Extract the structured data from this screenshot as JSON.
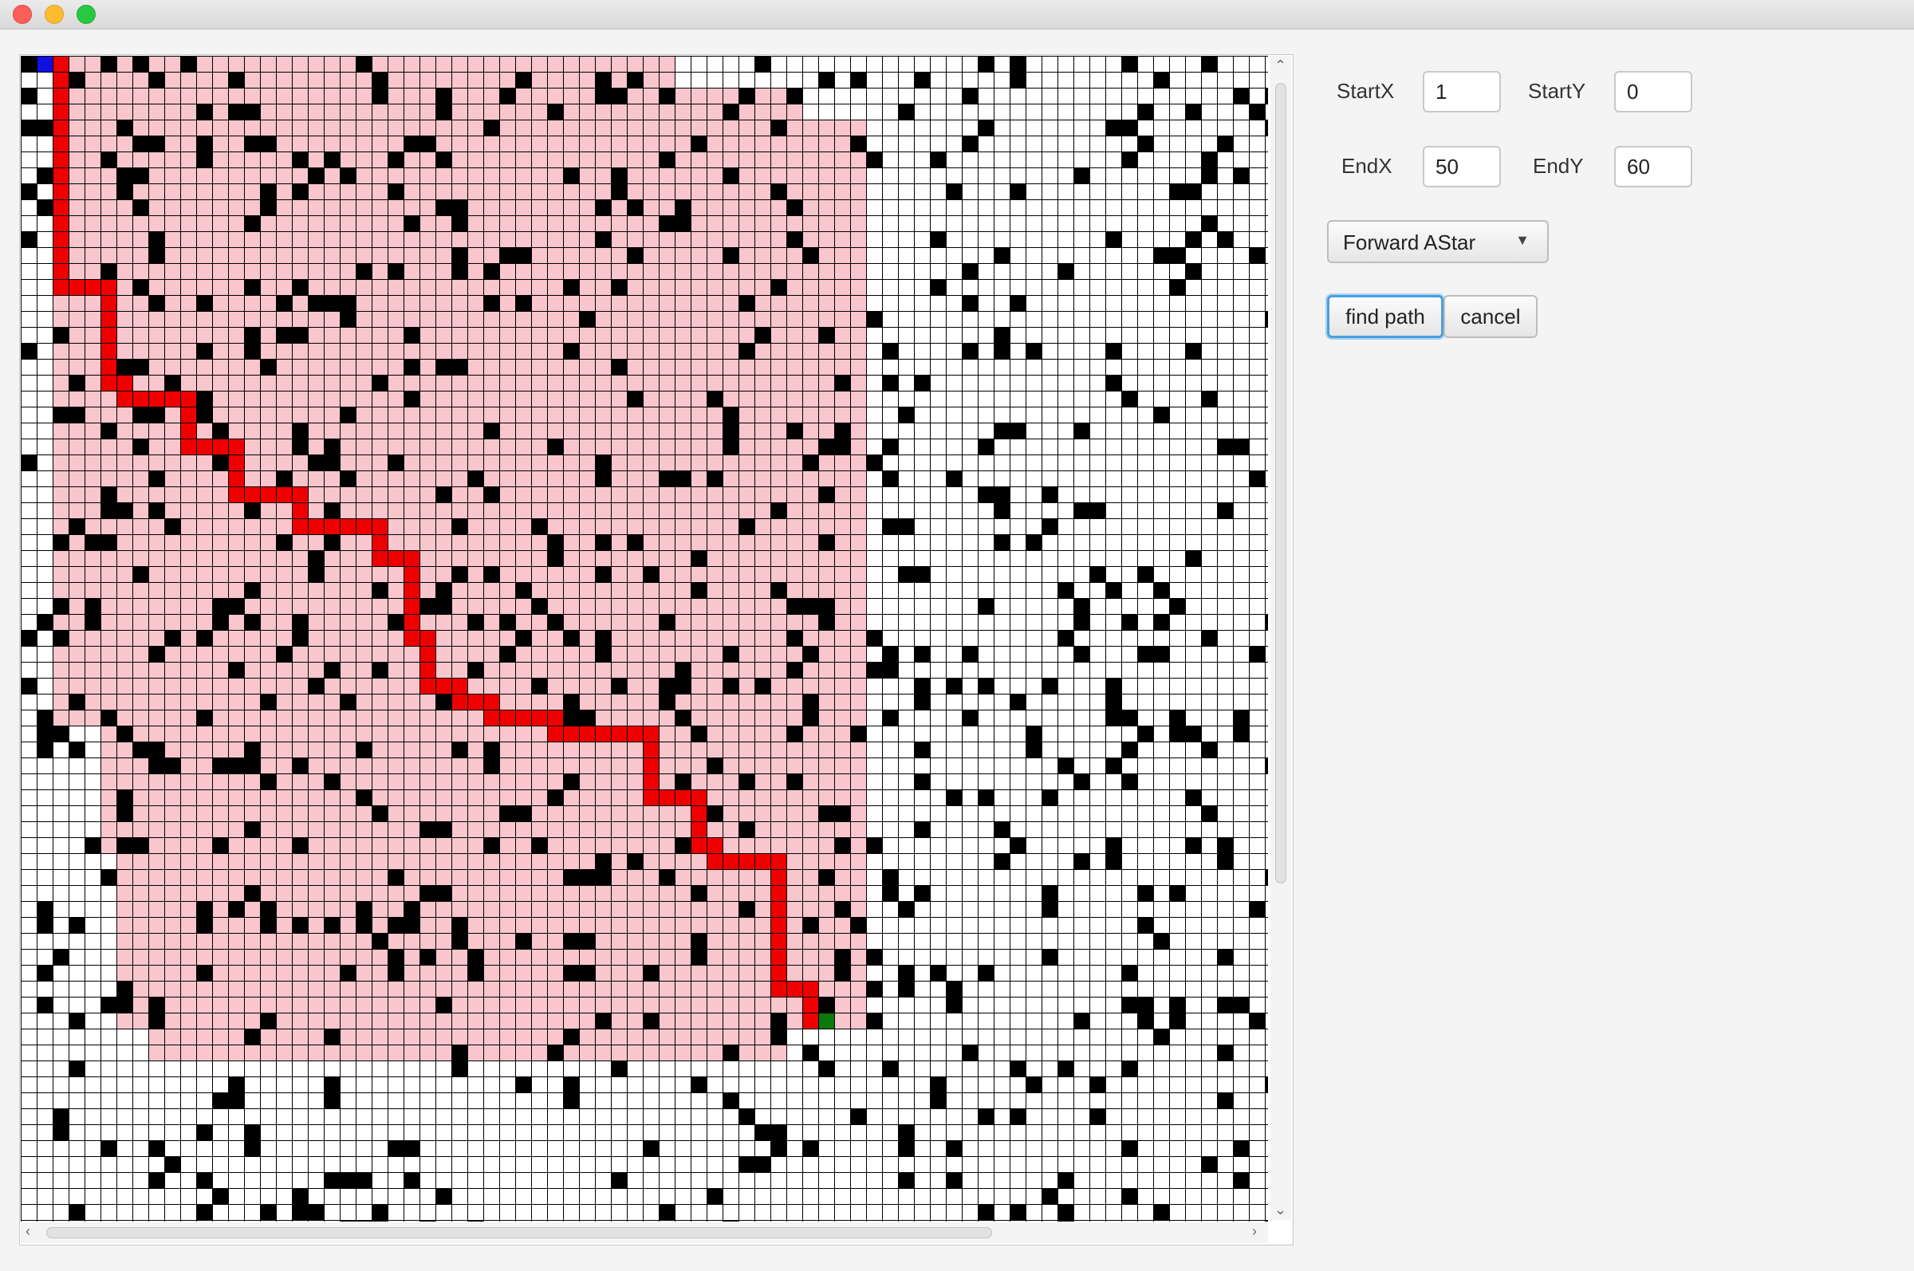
{
  "controls": {
    "start_x_label": "StartX",
    "start_x_value": "1",
    "start_y_label": "StartY",
    "start_y_value": "0",
    "end_x_label": "EndX",
    "end_x_value": "50",
    "end_y_label": "EndY",
    "end_y_value": "60",
    "algorithm_selected": "Forward AStar",
    "find_path_label": "find path",
    "cancel_label": "cancel"
  },
  "grid": {
    "start_cell": {
      "col": 1,
      "row": 0
    },
    "goal_cell": {
      "col": 50,
      "row": 60
    },
    "colors": {
      "empty": "#ffffff",
      "blocked": "#000000",
      "explored": "#f8c6cc",
      "path": "#ee0000",
      "start": "#1010e0",
      "goal": "#0a7a0a",
      "grid_line": "#000000"
    }
  }
}
